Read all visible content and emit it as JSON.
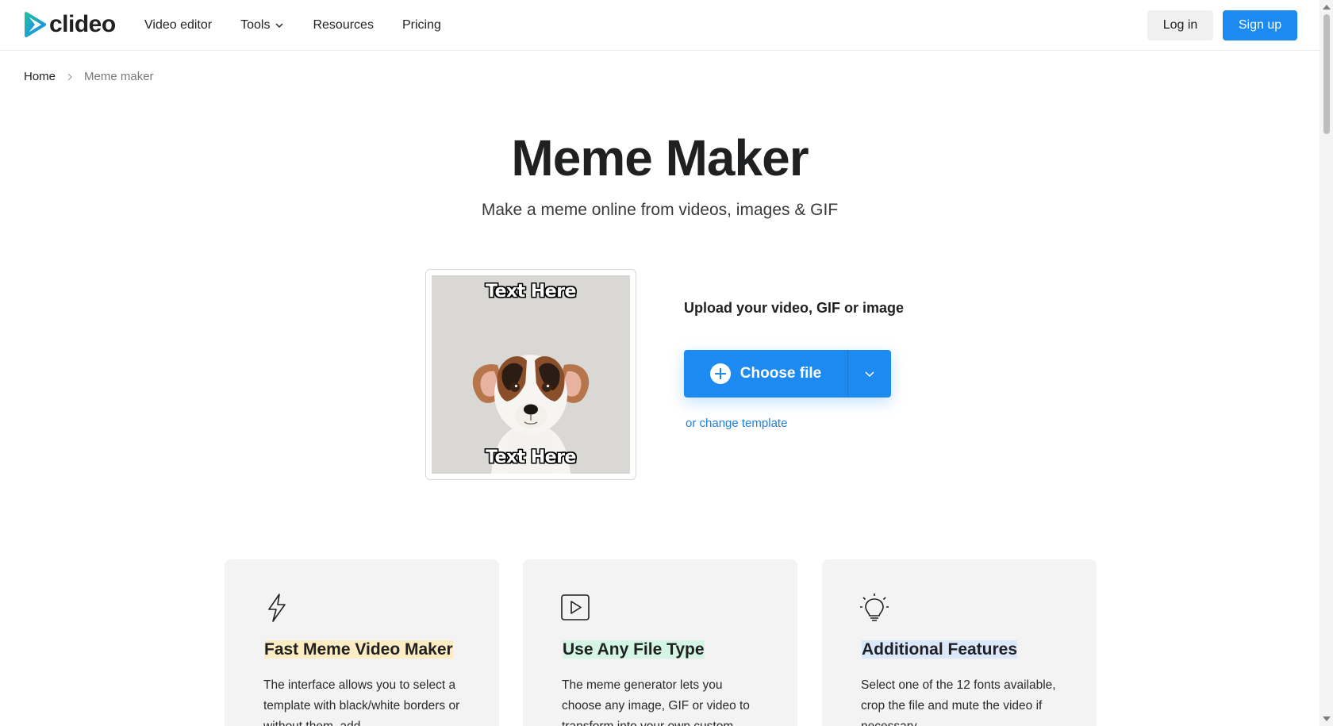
{
  "header": {
    "logo_text": "clideo",
    "nav": [
      {
        "label": "Video editor"
      },
      {
        "label": "Tools"
      },
      {
        "label": "Resources"
      },
      {
        "label": "Pricing"
      }
    ],
    "login_label": "Log in",
    "signup_label": "Sign up"
  },
  "breadcrumb": {
    "home": "Home",
    "current": "Meme maker"
  },
  "hero": {
    "title": "Meme Maker",
    "subtitle": "Make a meme online from videos, images & GIF"
  },
  "preview": {
    "top_text": "Text Here",
    "bottom_text": "Text Here"
  },
  "upload": {
    "label": "Upload your video, GIF or image",
    "choose_label": "Choose file",
    "change_template": "or change template"
  },
  "features": [
    {
      "icon": "lightning-icon",
      "title": "Fast Meme Video Maker",
      "text": "The interface allows you to select a template with black/white borders or without them, add"
    },
    {
      "icon": "play-icon",
      "title": "Use Any File Type",
      "text": "The meme generator lets you choose any image, GIF or video to transform into your own custom"
    },
    {
      "icon": "lightbulb-icon",
      "title": "Additional Features",
      "text": "Select one of the 12 fonts available, crop the file and mute the video if necessary"
    }
  ],
  "colors": {
    "accent": "#1d8af2",
    "logo_teal": "#1fbfa0",
    "highlight_yellow": "#fbecc4",
    "highlight_green": "#d4f5e3",
    "highlight_blue": "#dbe8fb"
  }
}
